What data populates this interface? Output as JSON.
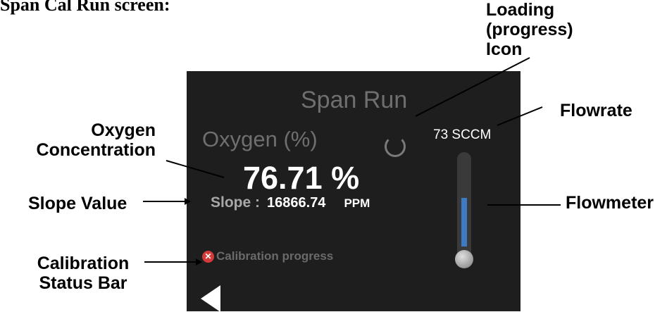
{
  "document": {
    "heading": "Span Cal Run screen:"
  },
  "screen": {
    "title": "Span Run",
    "oxygen_label": "Oxygen (%)",
    "oxygen_value": "76.71 %",
    "slope_label": "Slope :",
    "slope_value": "16866.74",
    "slope_unit": "PPM",
    "status_text": "Calibration progress",
    "status_icon": "error-x-icon",
    "flowrate": "73 SCCM",
    "flowmeter_level": 0.55,
    "colors": {
      "background": "#1e1e1e",
      "flow_fill": "#3d7cc4",
      "status_error": "#d33a3a"
    }
  },
  "annotations": {
    "loading": [
      "Loading",
      "(progress)",
      "Icon"
    ],
    "oxygen": [
      "Oxygen",
      "Concentration"
    ],
    "slope": "Slope Value",
    "calibration": [
      "Calibration",
      "Status Bar"
    ],
    "flowrate": "Flowrate",
    "flowmeter": "Flowmeter"
  }
}
